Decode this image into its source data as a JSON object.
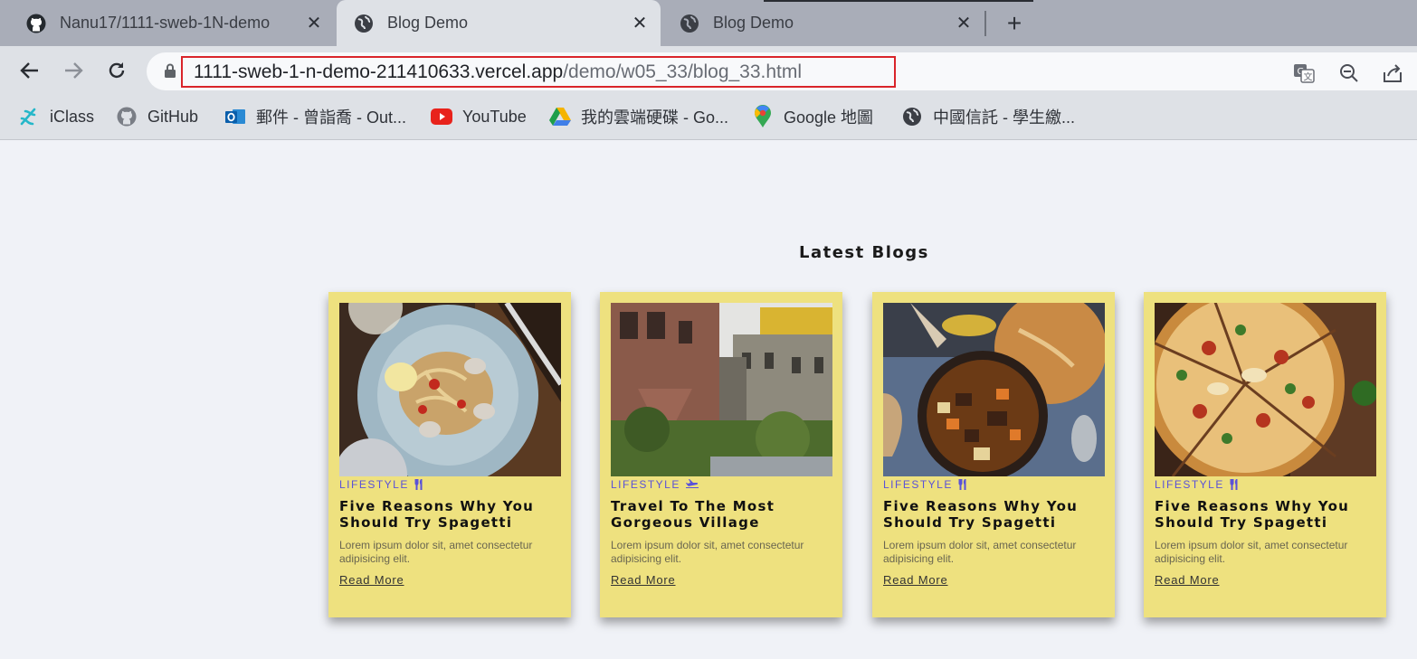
{
  "browser": {
    "tabs": [
      {
        "title": "Nanu17/1111-sweb-1N-demo",
        "icon": "github-icon",
        "active": false
      },
      {
        "title": "Blog Demo",
        "icon": "globe-icon",
        "active": true
      },
      {
        "title": "Blog Demo",
        "icon": "globe-icon",
        "active": false
      }
    ],
    "new_tab": "+",
    "close_glyph": "✕",
    "url": {
      "host": "1111-sweb-1-n-demo-211410633.vercel.app",
      "path": "/demo/w05_33/blog_33.html"
    },
    "bookmarks": [
      {
        "label": "iClass",
        "icon": "iclass-icon"
      },
      {
        "label": "GitHub",
        "icon": "github-icon"
      },
      {
        "label": "郵件 - 曾詣喬 - Out...",
        "icon": "outlook-icon"
      },
      {
        "label": "YouTube",
        "icon": "youtube-icon"
      },
      {
        "label": "我的雲端硬碟 - Go...",
        "icon": "google-drive-icon"
      },
      {
        "label": "Google 地圖",
        "icon": "google-maps-icon"
      },
      {
        "label": "中國信託 - 學生繳...",
        "icon": "globe-icon"
      }
    ],
    "accent_colors": {
      "url_highlight": "#d9242a"
    }
  },
  "page": {
    "section_title": "Latest Blogs",
    "card_color": "#eee17f",
    "category_color": "#5a52d8",
    "cards": [
      {
        "category": "LIFESTYLE",
        "category_icon": "utensils-icon",
        "title": "Five Reasons Why You Should Try Spagetti",
        "description": "Lorem ipsum dolor sit, amet consectetur adipisicing elit.",
        "link": "Read More",
        "image": "spaghetti-dish"
      },
      {
        "category": "LIFESTYLE",
        "category_icon": "plane-icon",
        "title": "Travel To The Most Gorgeous Village",
        "description": "Lorem ipsum dolor sit, amet consectetur adipisicing elit.",
        "link": "Read More",
        "image": "stone-village"
      },
      {
        "category": "LIFESTYLE",
        "category_icon": "utensils-icon",
        "title": "Five Reasons Why You Should Try Spagetti",
        "description": "Lorem ipsum dolor sit, amet consectetur adipisicing elit.",
        "link": "Read More",
        "image": "beef-stew"
      },
      {
        "category": "LIFESTYLE",
        "category_icon": "utensils-icon",
        "title": "Five Reasons Why You Should Try Spagetti",
        "description": "Lorem ipsum dolor sit, amet consectetur adipisicing elit.",
        "link": "Read More",
        "image": "pizza"
      }
    ]
  }
}
